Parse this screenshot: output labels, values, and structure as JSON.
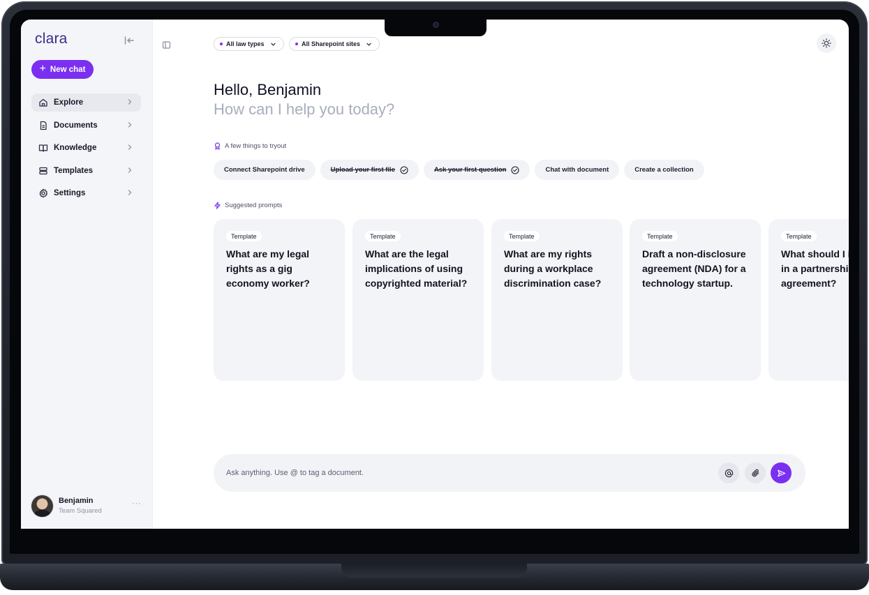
{
  "app": {
    "logo": "clara"
  },
  "sidebar": {
    "new_chat_label": "New chat",
    "items": [
      {
        "label": "Explore",
        "icon": "home-icon",
        "active": true
      },
      {
        "label": "Documents",
        "icon": "document-icon",
        "active": false
      },
      {
        "label": "Knowledge",
        "icon": "book-icon",
        "active": false
      },
      {
        "label": "Templates",
        "icon": "templates-icon",
        "active": false
      },
      {
        "label": "Settings",
        "icon": "gear-icon",
        "active": false
      }
    ],
    "user": {
      "name": "Benjamin",
      "team": "Team Squared",
      "more": "···"
    }
  },
  "filters": [
    {
      "label": "All law types"
    },
    {
      "label": "All Sharepoint sites"
    }
  ],
  "greeting": {
    "title": "Hello, Benjamin",
    "subtitle": "How can I help you today?"
  },
  "tryout": {
    "label": "A few things to tryout",
    "chips": [
      {
        "label": "Connect Sharepoint drive",
        "done": false
      },
      {
        "label": "Upload your first file",
        "done": true
      },
      {
        "label": "Ask your first question",
        "done": true
      },
      {
        "label": "Chat with document",
        "done": false
      },
      {
        "label": "Create a collection",
        "done": false
      }
    ]
  },
  "prompts": {
    "label": "Suggested prompts",
    "cards": [
      {
        "tag": "Template",
        "text": "What are my legal rights as a gig economy worker?"
      },
      {
        "tag": "Template",
        "text": "What are the legal implications of using copyrighted material?"
      },
      {
        "tag": "Template",
        "text": "What are my rights during a workplace discrimination case?"
      },
      {
        "tag": "Template",
        "text": "Draft a non-disclosure agreement (NDA) for a technology startup."
      },
      {
        "tag": "Template",
        "text": "What should I include in a partnership agreement?"
      }
    ]
  },
  "composer": {
    "placeholder": "Ask anything. Use @ to tag a document."
  },
  "colors": {
    "accent": "#7b2ff0",
    "sidebar_bg": "#f4f5f8",
    "card_bg": "#f3f4f7"
  }
}
